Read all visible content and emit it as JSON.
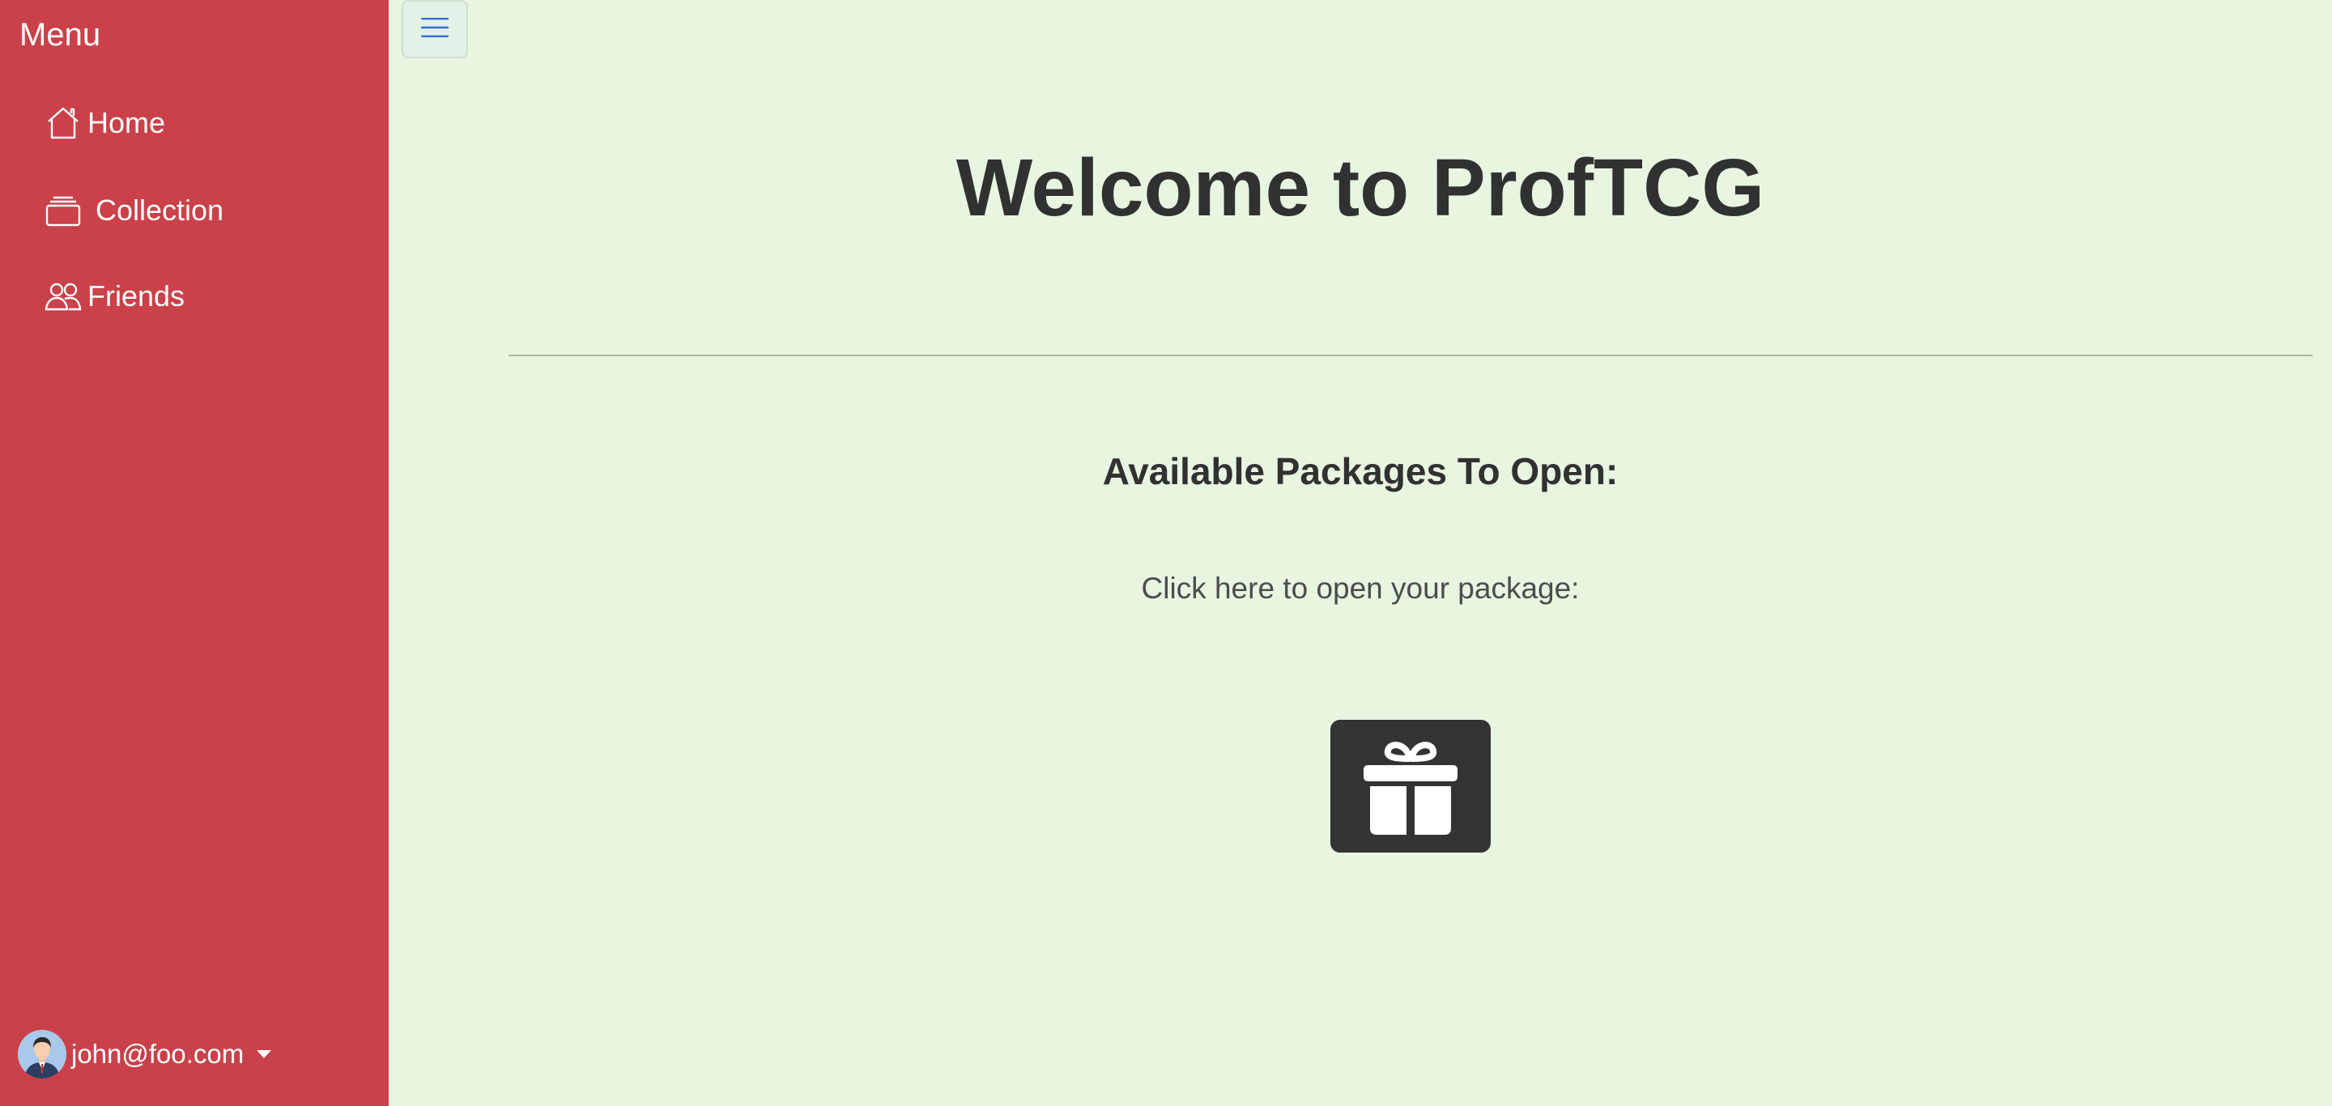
{
  "sidebar": {
    "title": "Menu",
    "items": [
      {
        "label": "Home",
        "icon": "house-icon"
      },
      {
        "label": "Collection",
        "icon": "collection-icon"
      },
      {
        "label": "Friends",
        "icon": "people-icon"
      }
    ],
    "user": {
      "email": "john@foo.com",
      "avatar": "user-avatar"
    }
  },
  "toggle": {
    "icon": "hamburger-icon"
  },
  "main": {
    "title": "Welcome to ProfTCG",
    "packages_heading": "Available Packages To Open:",
    "click_hint": "Click here to open your package:",
    "package_icon": "gift-icon"
  },
  "colors": {
    "sidebar_bg": "#ca4149",
    "page_bg": "#e8f5e1",
    "toggle_accent": "#2f6fdb",
    "gift_bg": "#333333",
    "text_dark": "#2f3230"
  }
}
